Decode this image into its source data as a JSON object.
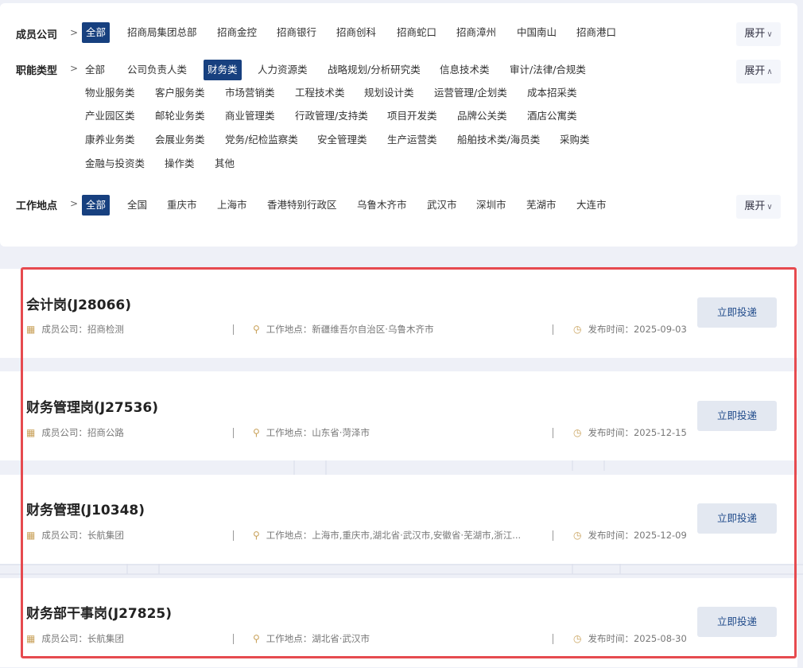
{
  "filters": {
    "company": {
      "label": "成员公司",
      "options": [
        "全部",
        "招商局集团总部",
        "招商金控",
        "招商银行",
        "招商创科",
        "招商蛇口",
        "招商漳州",
        "中国南山",
        "招商港口"
      ],
      "active": 0,
      "expand_label": "展开"
    },
    "function": {
      "label": "职能类型",
      "rows": [
        [
          "全部",
          "公司负责人类",
          "财务类",
          "人力资源类",
          "战略规划/分析研究类",
          "信息技术类",
          "审计/法律/合规类"
        ],
        [
          "物业服务类",
          "客户服务类",
          "市场营销类",
          "工程技术类",
          "规划设计类",
          "运营管理/企划类",
          "成本招采类"
        ],
        [
          "产业园区类",
          "邮轮业务类",
          "商业管理类",
          "行政管理/支持类",
          "项目开发类",
          "品牌公关类",
          "酒店公寓类"
        ],
        [
          "康养业务类",
          "会展业务类",
          "党务/纪检监察类",
          "安全管理类",
          "生产运营类",
          "船舶技术类/海员类",
          "采购类"
        ],
        [
          "金融与投资类",
          "操作类",
          "其他"
        ]
      ],
      "active": "财务类",
      "expand_label": "展开"
    },
    "location": {
      "label": "工作地点",
      "options": [
        "全部",
        "全国",
        "重庆市",
        "上海市",
        "香港特别行政区",
        "乌鲁木齐市",
        "武汉市",
        "深圳市",
        "芜湖市",
        "大连市"
      ],
      "active": 0,
      "expand_label": "展开"
    }
  },
  "jobs": [
    {
      "title": "会计岗(J28066)",
      "company": "成员公司：招商检测",
      "location": "工作地点：新疆维吾尔自治区·乌鲁木齐市",
      "date": "发布时间：2025-09-03",
      "apply": "立即投递"
    },
    {
      "title": "财务管理岗(J27536)",
      "company": "成员公司：招商公路",
      "location": "工作地点：山东省·菏泽市",
      "date": "发布时间：2025-12-15",
      "apply": "立即投递"
    },
    {
      "title": "财务管理(J10348)",
      "company": "成员公司：长航集团",
      "location": "工作地点：上海市,重庆市,湖北省·武汉市,安徽省·芜湖市,浙江...",
      "date": "发布时间：2025-12-09",
      "apply": "立即投递"
    },
    {
      "title": "财务部干事岗(J27825)",
      "company": "成员公司：长航集团",
      "location": "工作地点：湖北省·武汉市",
      "date": "发布时间：2025-08-30",
      "apply": "立即投递"
    }
  ],
  "icons": {
    "arrow": "chevron-right-icon",
    "expand": "chevron-down-icon",
    "collapse": "chevron-up-icon",
    "company": "grid-icon",
    "location": "location-pin-icon",
    "time": "clock-icon"
  },
  "colors": {
    "active_bg": "#17407f",
    "highlight": "#e64a4f",
    "button_bg": "#e3e8f1",
    "button_text": "#1f4a8a",
    "icon_gold": "#c9a25b"
  }
}
